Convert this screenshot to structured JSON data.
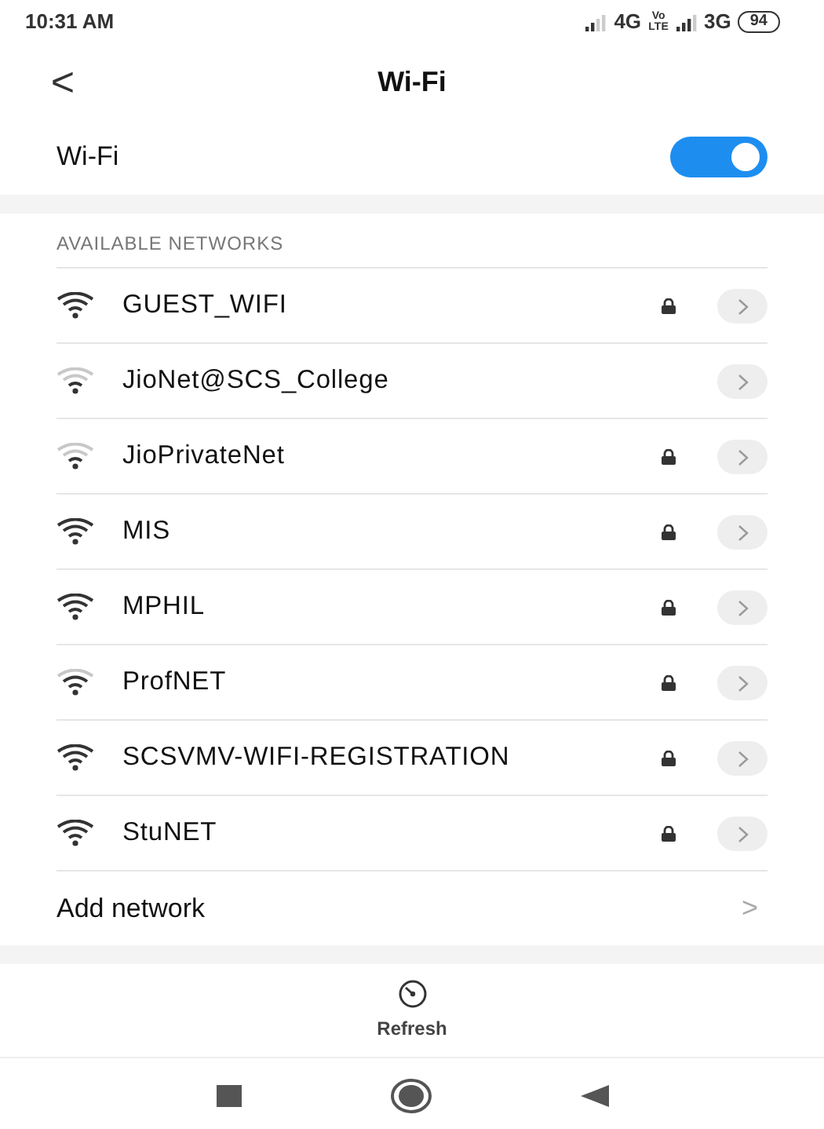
{
  "status_bar": {
    "time": "10:31 AM",
    "network_1": "4G",
    "volte": "Vo LTE",
    "network_2": "3G",
    "battery": "94"
  },
  "header": {
    "back": "<",
    "title": "Wi-Fi"
  },
  "wifi_toggle": {
    "label": "Wi-Fi",
    "on": true
  },
  "section_title": "AVAILABLE NETWORKS",
  "networks": [
    {
      "name": "GUEST_WIFI",
      "kind": "strong",
      "secured": true
    },
    {
      "name": "JioNet@SCS_College",
      "kind": "weak",
      "secured": false
    },
    {
      "name": "JioPrivateNet",
      "kind": "weak",
      "secured": true
    },
    {
      "name": "MIS",
      "kind": "strong",
      "secured": true
    },
    {
      "name": "MPHIL",
      "kind": "strong",
      "secured": true
    },
    {
      "name": "ProfNET",
      "kind": "medium",
      "secured": true
    },
    {
      "name": "SCSVMV-WIFI-REGISTRATION",
      "kind": "strong",
      "secured": true
    },
    {
      "name": "StuNET",
      "kind": "strong",
      "secured": true
    }
  ],
  "add_network": {
    "label": "Add network",
    "chevron": ">"
  },
  "bottom_action": {
    "label": "Refresh"
  }
}
